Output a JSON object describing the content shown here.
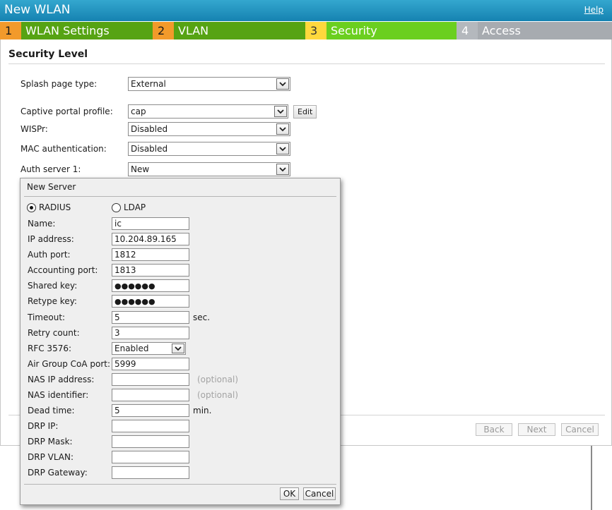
{
  "window": {
    "title": "New WLAN",
    "help_label": "Help"
  },
  "steps": [
    {
      "num": "1",
      "label": "WLAN Settings"
    },
    {
      "num": "2",
      "label": "VLAN"
    },
    {
      "num": "3",
      "label": "Security"
    },
    {
      "num": "4",
      "label": "Access"
    }
  ],
  "section": {
    "title": "Security Level",
    "fields": {
      "splash_page_type": {
        "label": "Splash page type:",
        "value": "External"
      },
      "captive_portal_profile": {
        "label": "Captive portal profile:",
        "value": "cap",
        "edit_label": "Edit"
      },
      "wispr": {
        "label": "WISPr:",
        "value": "Disabled"
      },
      "mac_auth": {
        "label": "MAC authentication:",
        "value": "Disabled"
      },
      "auth_server_1": {
        "label": "Auth server 1:",
        "value": "New"
      }
    }
  },
  "nav": {
    "back": "Back",
    "next": "Next",
    "cancel": "Cancel"
  },
  "dialog": {
    "title": "New Server",
    "radio_radius": "RADIUS",
    "radio_ldap": "LDAP",
    "selected": "RADIUS",
    "fields": {
      "name": {
        "label": "Name:",
        "value": "ic"
      },
      "ip_address": {
        "label": "IP address:",
        "value": "10.204.89.165"
      },
      "auth_port": {
        "label": "Auth port:",
        "value": "1812"
      },
      "accounting_port": {
        "label": "Accounting port:",
        "value": "1813"
      },
      "shared_key": {
        "label": "Shared key:",
        "value": "●●●●●●"
      },
      "retype_key": {
        "label": "Retype key:",
        "value": "●●●●●●"
      },
      "timeout": {
        "label": "Timeout:",
        "value": "5",
        "suffix": "sec."
      },
      "retry_count": {
        "label": "Retry count:",
        "value": "3"
      },
      "rfc3576": {
        "label": "RFC 3576:",
        "value": "Enabled"
      },
      "air_group_coa_port": {
        "label": "Air Group CoA port:",
        "value": "5999"
      },
      "nas_ip_address": {
        "label": "NAS IP address:",
        "value": "",
        "hint": "(optional)"
      },
      "nas_identifier": {
        "label": "NAS identifier:",
        "value": "",
        "hint": "(optional)"
      },
      "dead_time": {
        "label": "Dead time:",
        "value": "5",
        "suffix": "min."
      },
      "drp_ip": {
        "label": "DRP IP:",
        "value": ""
      },
      "drp_mask": {
        "label": "DRP Mask:",
        "value": ""
      },
      "drp_vlan": {
        "label": "DRP VLAN:",
        "value": ""
      },
      "drp_gateway": {
        "label": "DRP Gateway:",
        "value": ""
      }
    },
    "ok_label": "OK",
    "cancel_label": "Cancel"
  },
  "icons": {
    "dropdown": "chevron-down-icon"
  }
}
